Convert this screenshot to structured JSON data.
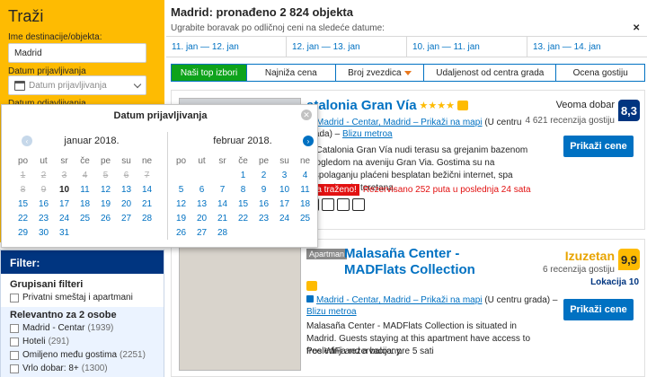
{
  "search": {
    "title": "Traži",
    "destination_label": "Ime destinacije/objekta:",
    "destination_value": "Madrid",
    "checkin_label": "Datum prijavljivanja",
    "checkin_placeholder": "Datum prijavljivanja",
    "checkout_label_partial": "Datum odjavljivanja"
  },
  "header": {
    "results_title": "Madrid: pronađeno 2 824 objekta",
    "date_hint": "Ugrabite boravak po odličnoj ceni na sledeće datume:",
    "date_options": [
      "11. jan — 12. jan",
      "12. jan — 13. jan",
      "10. jan — 11. jan",
      "13. jan — 14. jan"
    ]
  },
  "sort": {
    "tabs": [
      "Naši top izbori",
      "Najniža cena",
      "Broj zvezdica",
      "Udaljenost od centra grada",
      "Ocena gostiju"
    ]
  },
  "hotel1": {
    "name_partial": "atalonia Gran Vía",
    "stars": "★★★★",
    "location_link": "Madrid - Centar, Madrid – Prikaži na mapi",
    "location_suffix": "(U centru",
    "location_line2": "grada) –",
    "metro_link": "Blizu metroa",
    "desc": "el Catalonia Gran Vía nudi terasu sa grejanim bazenom i pogledom na aveniju Gran Via. Gostima su na raspolaganju plaćeni besplatan bežični internet, spa centar i mala teretana.",
    "badge": "ma traženo!",
    "booked_text": "Rezervisano 252 puta u poslednja 24 sata",
    "rating_word": "Veoma dobar",
    "reviews": "4 621 recenzija gostiju",
    "score": "8,3",
    "button": "Prikaži cene"
  },
  "hotel2": {
    "type_badge": "Apartman",
    "name": "Malasaña Center - MADFlats Collection",
    "location_link": "Madrid - Centar, Madrid – Prikaži na mapi",
    "location_suffix": "(U centru grada) –",
    "metro_link": "Blizu metroa",
    "desc": "Malasaña Center - MADFlats Collection is situated in Madrid. Guests staying at this apartment have access to free WiFi and a balcony.",
    "last_booking": "Poslednja rezervacija: pre 5 sati",
    "rating_word": "Izuzetan",
    "reviews": "6 recenzija gostiju",
    "location_score": "Lokacija 10",
    "score": "9,9",
    "button": "Prikaži cene"
  },
  "filter": {
    "title": "Filter:",
    "group1_title": "Grupisani filteri",
    "group1_items": [
      {
        "label": "Privatni smeštaj i apartmani",
        "count": ""
      }
    ],
    "group2_title": "Relevantno za 2 osobe",
    "group2_items": [
      {
        "label": "Madrid - Centar",
        "count": "(1939)"
      },
      {
        "label": "Hoteli",
        "count": "(291)"
      },
      {
        "label": "Omiljeno među gostima",
        "count": "(2251)"
      },
      {
        "label": "Vrlo dobar: 8+",
        "count": "(1300)"
      }
    ]
  },
  "picker": {
    "title": "Datum prijavljivanja",
    "close_glyph": "✕",
    "prev_glyph": "‹",
    "next_glyph": "›",
    "month1": "januar 2018.",
    "month2": "februar 2018.",
    "weekdays": [
      "po",
      "ut",
      "sr",
      "če",
      "pe",
      "su",
      "ne"
    ],
    "month1_weeks": [
      [
        "1",
        "2",
        "3",
        "4",
        "5",
        "6",
        "7"
      ],
      [
        "8",
        "9",
        "10",
        "11",
        "12",
        "13",
        "14"
      ],
      [
        "15",
        "16",
        "17",
        "18",
        "19",
        "20",
        "21"
      ],
      [
        "22",
        "23",
        "24",
        "25",
        "26",
        "27",
        "28"
      ],
      [
        "29",
        "30",
        "31",
        "",
        "",
        "",
        ""
      ]
    ],
    "month1_past_until": 9,
    "month1_today": "10",
    "month2_weeks": [
      [
        "",
        "",
        "",
        "1",
        "2",
        "3",
        "4"
      ],
      [
        "5",
        "6",
        "7",
        "8",
        "9",
        "10",
        "11"
      ],
      [
        "12",
        "13",
        "14",
        "15",
        "16",
        "17",
        "18"
      ],
      [
        "19",
        "20",
        "21",
        "22",
        "23",
        "24",
        "25"
      ],
      [
        "26",
        "27",
        "28",
        "",
        "",
        "",
        ""
      ]
    ]
  },
  "colors": {
    "brand_blue": "#003580",
    "link_blue": "#0071c2",
    "search_yellow": "#febb02",
    "active_green": "#0ea31b",
    "urgent_red": "#e21111"
  }
}
